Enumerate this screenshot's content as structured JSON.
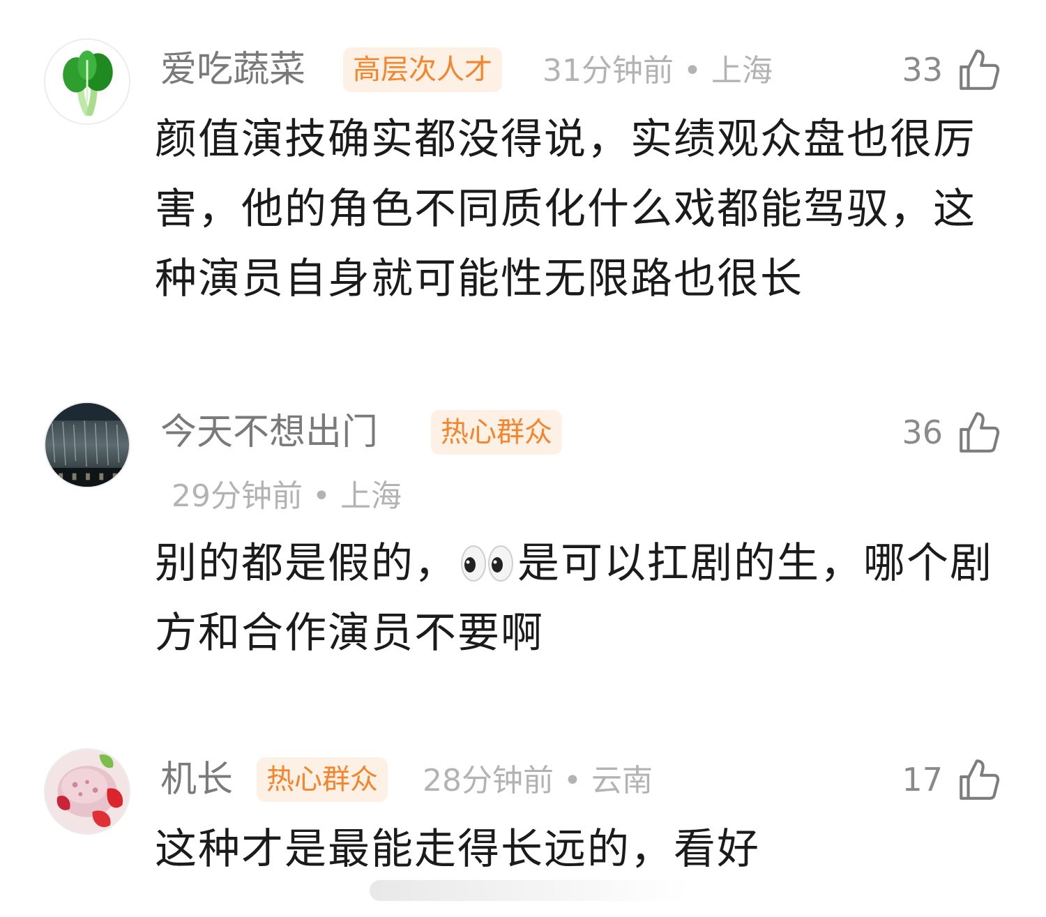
{
  "comments": [
    {
      "avatar_icon": "bok-choy-avatar",
      "username": "爱吃蔬菜",
      "badge": "高层次人才",
      "time": "31分钟前",
      "location": "上海",
      "likes": "33",
      "text": "颜值演技确实都没得说，实绩观众盘也很厉害，他的角色不同质化什么戏都能驾驭，这种演员自身就可能性无限路也很长"
    },
    {
      "avatar_icon": "rain-scene-avatar",
      "username": "今天不想出门",
      "badge": "热心群众",
      "time": "29分钟前",
      "location": "上海",
      "likes": "36",
      "text_before_emoji": "别的都是假的，",
      "emoji": "eyes-emoji",
      "text_after_emoji": "是可以扛剧的生，哪个剧方和合作演员不要啊"
    },
    {
      "avatar_icon": "strawberry-icecream-avatar",
      "username": "机长",
      "badge": "热心群众",
      "time": "28分钟前",
      "location": "云南",
      "likes": "17",
      "text": "这种才是最能走得长远的，看好"
    }
  ],
  "meta_separator": "•",
  "colors": {
    "badge_text": "#f5842b",
    "badge_bg": "#fdf1e6",
    "username": "#7a7a7a",
    "meta": "#b3b3b3",
    "body": "#1b1b1b"
  }
}
